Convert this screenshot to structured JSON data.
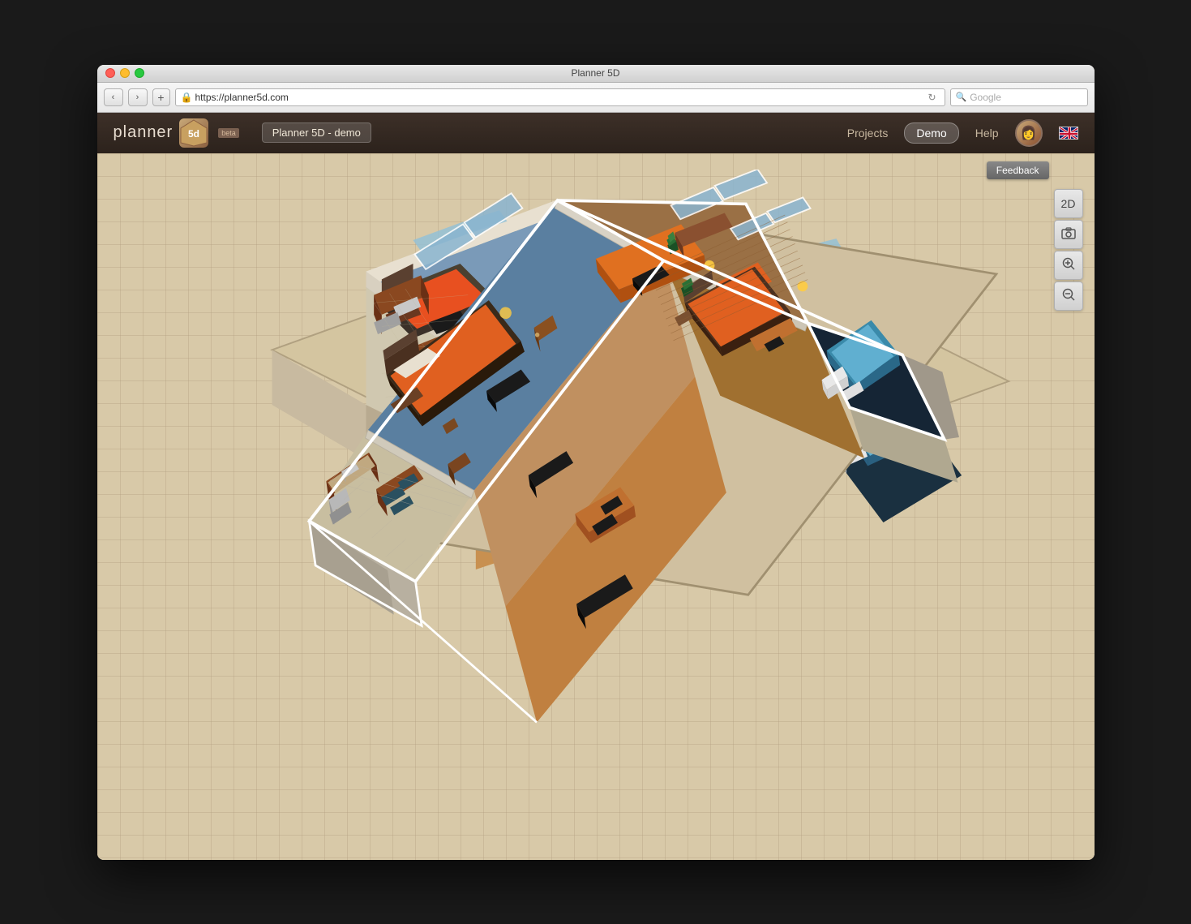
{
  "window": {
    "title": "Planner 5D",
    "buttons": {
      "close": "close",
      "minimize": "minimize",
      "maximize": "maximize"
    }
  },
  "browser": {
    "back_label": "‹",
    "forward_label": "›",
    "add_label": "+",
    "url": "https://planner5d.com",
    "reload_label": "↻",
    "search_placeholder": "Google"
  },
  "app_header": {
    "logo_text": "planner",
    "logo_num": "5d",
    "beta_label": "beta",
    "project_name": "Planner 5D - demo",
    "nav_items": [
      {
        "label": "Projects",
        "active": false
      },
      {
        "label": "Demo",
        "active": true
      },
      {
        "label": "Help",
        "active": false
      }
    ],
    "flag_alt": "English"
  },
  "toolbar": {
    "feedback_label": "Feedback",
    "buttons": [
      {
        "id": "2d",
        "label": "2D",
        "active": false
      },
      {
        "id": "screenshot",
        "label": "📷",
        "active": false
      },
      {
        "id": "zoom-in",
        "label": "🔍+",
        "active": false
      },
      {
        "id": "zoom-out",
        "label": "🔍-",
        "active": false
      }
    ]
  },
  "floorplan": {
    "description": "3D isometric floor plan with multiple rooms including bedroom, office, kitchen, bathroom"
  }
}
